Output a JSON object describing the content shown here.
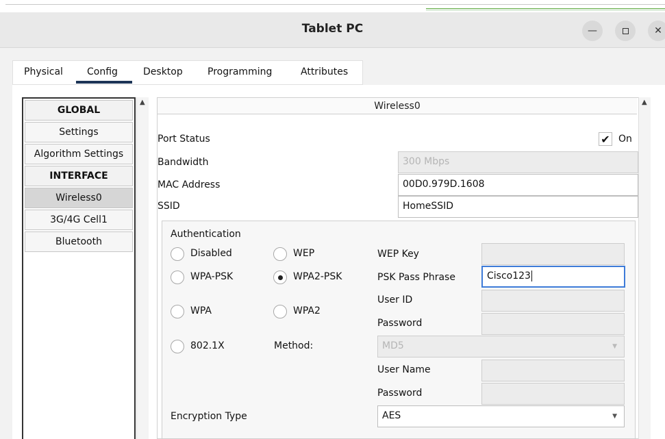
{
  "window": {
    "title": "Tablet PC"
  },
  "tabs": [
    "Physical",
    "Config",
    "Desktop",
    "Programming",
    "Attributes"
  ],
  "active_tab": "Config",
  "sidebar": {
    "items": [
      "GLOBAL",
      "Settings",
      "Algorithm Settings",
      "INTERFACE",
      "Wireless0",
      "3G/4G Cell1",
      "Bluetooth"
    ],
    "active": "Wireless0"
  },
  "content": {
    "header": "Wireless0",
    "port_status": {
      "label": "Port Status",
      "checkbox_label": "On",
      "checked": true
    },
    "bandwidth": {
      "label": "Bandwidth",
      "value": "300 Mbps"
    },
    "mac": {
      "label": "MAC Address",
      "value": "00D0.979D.1608"
    },
    "ssid": {
      "label": "SSID",
      "value": "HomeSSID"
    },
    "auth": {
      "title": "Authentication",
      "options": [
        "Disabled",
        "WEP",
        "WPA-PSK",
        "WPA2-PSK",
        "WPA",
        "WPA2",
        "802.1X"
      ],
      "selected": "WPA2-PSK",
      "wep_key_label": "WEP Key",
      "psk_label": "PSK Pass Phrase",
      "psk_value": "Cisco123",
      "user_id_label": "User ID",
      "password_label": "Password",
      "method_label": "Method:",
      "method_value": "MD5",
      "user_name_label": "User Name",
      "password2_label": "Password",
      "encryption_label": "Encryption Type",
      "encryption_value": "AES"
    }
  }
}
